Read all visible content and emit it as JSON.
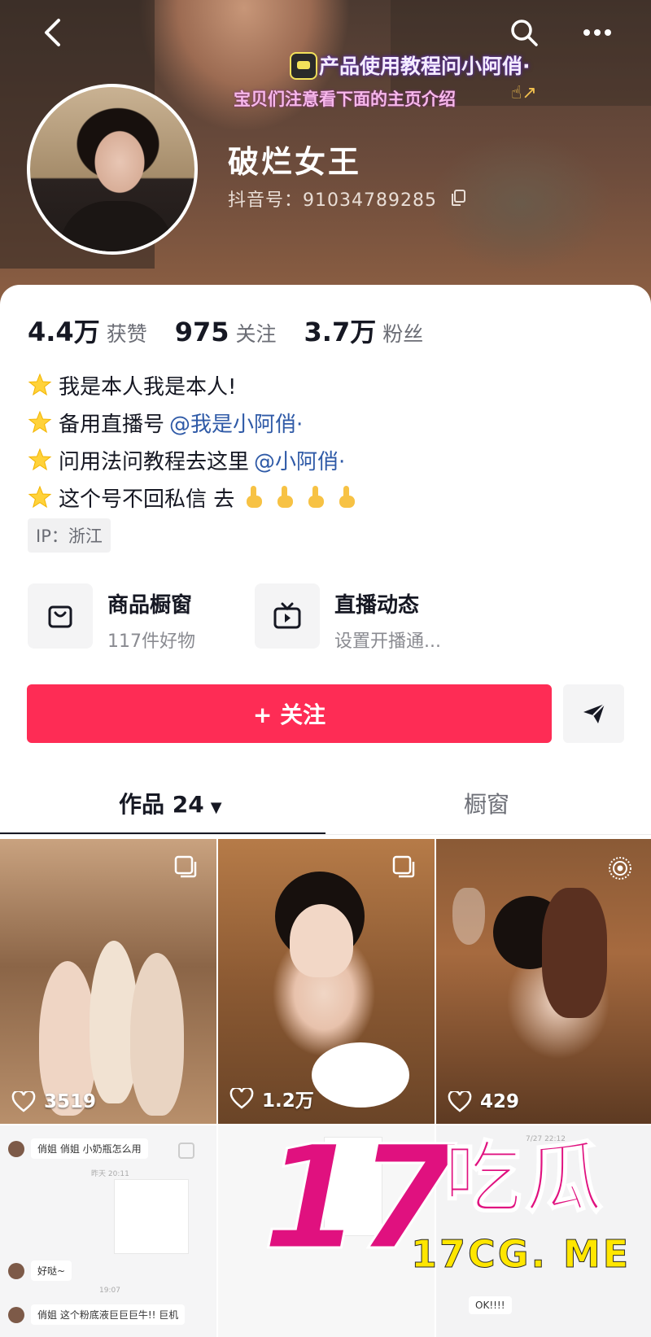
{
  "header": {
    "banner_line1": "产品使用教程问小阿俏·",
    "banner_line2": "宝贝们注意看下面的主页介绍",
    "nickname": "破烂女王",
    "douyin_id_label": "抖音号：91034789285"
  },
  "stats": {
    "likes_value": "4.4万",
    "likes_label": "获赞",
    "following_value": "975",
    "following_label": "关注",
    "followers_value": "3.7万",
    "followers_label": "粉丝"
  },
  "bio": {
    "line1": "我是本人我是本人!",
    "line2_text": "备用直播号",
    "line2_mention": "@我是小阿俏·",
    "line3_text": "问用法问教程去这里",
    "line3_mention": "@小阿俏·",
    "line4_text": "这个号不回私信 去"
  },
  "ip_location": "IP：浙江",
  "features": {
    "shop_title": "商品橱窗",
    "shop_sub": "117件好物",
    "live_title": "直播动态",
    "live_sub": "设置开播通..."
  },
  "follow_button": "+ 关注",
  "tabs": {
    "works_label": "作品 24",
    "window_label": "橱窗"
  },
  "videos": [
    {
      "likes": "3519"
    },
    {
      "likes": "1.2万"
    },
    {
      "likes": "429"
    }
  ],
  "chat_preview": {
    "msg1": "俏姐 俏姐 小奶瓶怎么用",
    "msg2": "好哒~",
    "msg3": "俏姐 这个粉底液巨巨巨牛!! 巨机",
    "time1": "昨天 20:11",
    "time2": "19:07",
    "time3": "7/27 22:12",
    "ok": "OK!!!!"
  },
  "watermark": {
    "number": "17",
    "chinese": "吃瓜",
    "url": "17CG. ME"
  },
  "colors": {
    "follow_red": "#fe2c55",
    "mention_blue": "#2f5aa7",
    "watermark_magenta": "#e0117f",
    "watermark_yellow": "#ffe600"
  }
}
